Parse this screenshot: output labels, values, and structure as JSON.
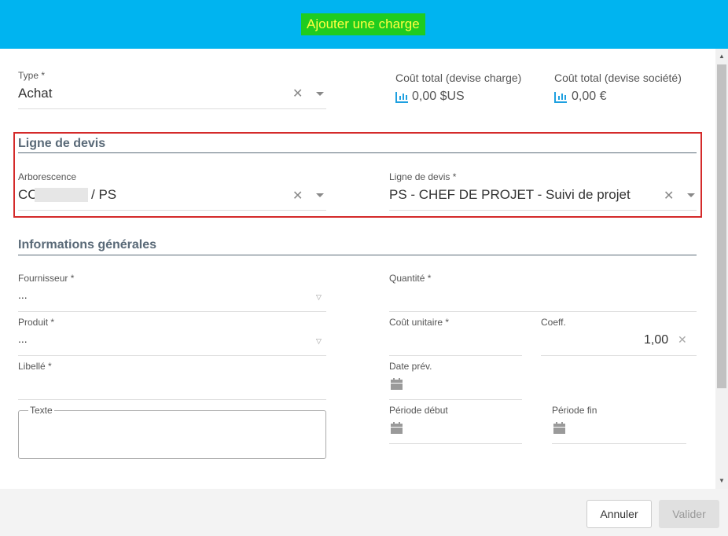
{
  "dialog": {
    "title": "Ajouter une charge"
  },
  "type_field": {
    "label": "Type *",
    "value": "Achat"
  },
  "totals": {
    "charge": {
      "label": "Coût total (devise charge)",
      "amount": "0,00 $US"
    },
    "societe": {
      "label": "Coût total (devise société)",
      "amount": "0,00 €"
    }
  },
  "ligne_devis_section": {
    "title": "Ligne de devis",
    "arborescence": {
      "label": "Arborescence",
      "prefix": "CC",
      "suffix": "/ PS"
    },
    "ligne_devis": {
      "label": "Ligne de devis *",
      "value": "PS - CHEF DE PROJET - Suivi de projet"
    }
  },
  "infos_section": {
    "title": "Informations générales",
    "fournisseur": {
      "label": "Fournisseur *",
      "value": "..."
    },
    "produit": {
      "label": "Produit *",
      "value": "..."
    },
    "libelle": {
      "label": "Libellé *",
      "value": ""
    },
    "texte": {
      "label": "Texte",
      "value": ""
    },
    "quantite": {
      "label": "Quantité *",
      "value": ""
    },
    "cout_unitaire": {
      "label": "Coût unitaire *",
      "value": ""
    },
    "coeff": {
      "label": "Coeff.",
      "value": "1,00"
    },
    "date_prev": {
      "label": "Date prév."
    },
    "periode_debut": {
      "label": "Période début"
    },
    "periode_fin": {
      "label": "Période fin"
    }
  },
  "footer": {
    "cancel_label": "Annuler",
    "validate_label": "Valider"
  },
  "colors": {
    "header": "#00b4f0",
    "title_bg": "#1fcc1f",
    "title_fg": "#ffff40",
    "highlight_box": "#d42a2a",
    "accent_icon": "#1ea0e0"
  },
  "icons": [
    "close-icon",
    "dropdown-caret-icon",
    "chart-icon",
    "calendar-icon"
  ]
}
